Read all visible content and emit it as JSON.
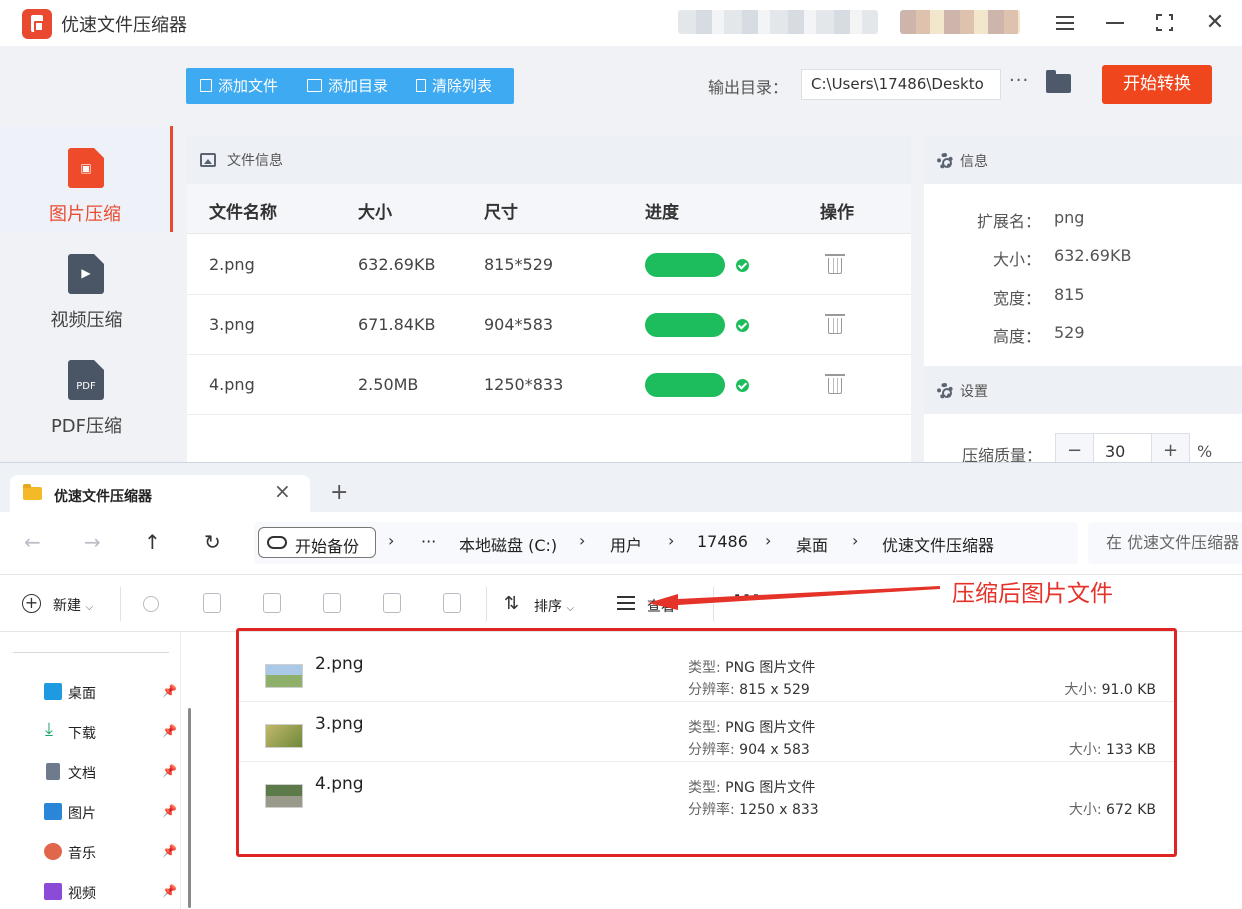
{
  "app": {
    "title": "优速文件压缩器",
    "sidebar": [
      {
        "label": "图片压缩",
        "icon": "image-file-icon",
        "active": true
      },
      {
        "label": "视频压缩",
        "icon": "video-file-icon",
        "active": false
      },
      {
        "label": "PDF压缩",
        "icon": "pdf-file-icon",
        "glyph": "PDF",
        "active": false
      }
    ],
    "toolbar": {
      "add_file": "添加文件",
      "add_dir": "添加目录",
      "clear_list": "清除列表",
      "output_label": "输出目录：",
      "output_path": "C:\\Users\\17486\\Deskto",
      "more": "···",
      "start": "开始转换"
    },
    "file_panel": {
      "title": "文件信息",
      "columns": [
        "文件名称",
        "大小",
        "尺寸",
        "进度",
        "操作"
      ],
      "rows": [
        {
          "name": "2.png",
          "size": "632.69KB",
          "dims": "815*529",
          "progress": 1.0,
          "done": true
        },
        {
          "name": "3.png",
          "size": "671.84KB",
          "dims": "904*583",
          "progress": 1.0,
          "done": true
        },
        {
          "name": "4.png",
          "size": "2.50MB",
          "dims": "1250*833",
          "progress": 1.0,
          "done": true
        }
      ]
    },
    "info_panel": {
      "title": "信息",
      "fields": [
        {
          "key": "扩展名：",
          "value": "png"
        },
        {
          "key": "大小：",
          "value": "632.69KB"
        },
        {
          "key": "宽度：",
          "value": "815"
        },
        {
          "key": "高度：",
          "value": "529"
        }
      ],
      "settings_title": "设置",
      "quality_label": "压缩质量：",
      "quality_value": "30",
      "quality_minus": "−",
      "quality_plus": "+",
      "quality_unit": "%"
    },
    "colors": {
      "accent": "#f0461d",
      "toolbar_blue": "#3eaaf1",
      "progress_green": "#1dbd5d"
    }
  },
  "explorer": {
    "tab_title": "优速文件压缩器",
    "tab_close": "×",
    "new_tab": "+",
    "nav": {
      "back": "←",
      "forward": "→",
      "up": "↑",
      "refresh": "↻"
    },
    "backup_button": "开始备份",
    "breadcrumb_sep": "›",
    "breadcrumb_overflow": "···",
    "breadcrumb": [
      "本地磁盘 (C:)",
      "用户",
      "17486",
      "桌面",
      "优速文件压缩器"
    ],
    "search_placeholder": "在 优速文件压缩器 中搜索",
    "commands": {
      "new": "新建",
      "new_chevron": "⌵",
      "sort": "排序",
      "sort_chevron": "⌵",
      "view": "查看",
      "more": "···"
    },
    "annotation": "压缩后图片文件",
    "quick_access": [
      {
        "label": "桌面",
        "icon": "desktop-icon",
        "color": "#1e9be0"
      },
      {
        "label": "下载",
        "icon": "download-icon",
        "color": "#1ba868"
      },
      {
        "label": "文档",
        "icon": "document-icon",
        "color": "#6d7b8c"
      },
      {
        "label": "图片",
        "icon": "pictures-icon",
        "color": "#2a87d8"
      },
      {
        "label": "音乐",
        "icon": "music-icon",
        "color": "#e0674c"
      },
      {
        "label": "视频",
        "icon": "videos-icon",
        "color": "#8c4bd6"
      }
    ],
    "pin_glyph": "📌",
    "files": [
      {
        "name": "2.png",
        "type_label": "类型:",
        "type": "PNG 图片文件",
        "res_label": "分辨率:",
        "resolution": "815 x 529",
        "size_label": "大小:",
        "size": "91.0 KB",
        "thumb": [
          "#a9c9e6",
          "#8fb06a"
        ]
      },
      {
        "name": "3.png",
        "type_label": "类型:",
        "type": "PNG 图片文件",
        "res_label": "分辨率:",
        "resolution": "904 x 583",
        "size_label": "大小:",
        "size": "133 KB",
        "thumb": [
          "#c3b76a",
          "#6e8a3a"
        ]
      },
      {
        "name": "4.png",
        "type_label": "类型:",
        "type": "PNG 图片文件",
        "res_label": "分辨率:",
        "resolution": "1250 x 833",
        "size_label": "大小:",
        "size": "672 KB",
        "thumb": [
          "#5d7a4a",
          "#9a9a8a"
        ]
      }
    ]
  }
}
